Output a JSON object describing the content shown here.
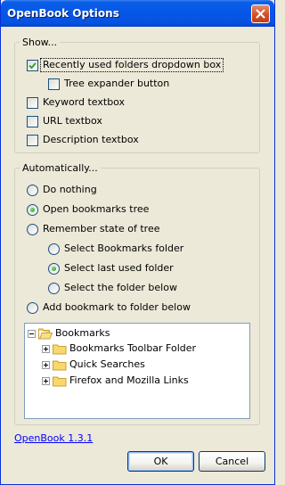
{
  "window": {
    "title": "OpenBook Options"
  },
  "show_group": {
    "title": "Show...",
    "items": [
      {
        "label": "Recently used folders dropdown box",
        "checked": true,
        "focused": true
      },
      {
        "label": "Tree expander button",
        "checked": false
      },
      {
        "label": "Keyword textbox",
        "checked": false
      },
      {
        "label": "URL textbox",
        "checked": false
      },
      {
        "label": "Description textbox",
        "checked": false
      }
    ]
  },
  "auto_group": {
    "title": "Automatically...",
    "options": [
      {
        "label": "Do nothing",
        "selected": false
      },
      {
        "label": "Open bookmarks tree",
        "selected": true
      },
      {
        "label": "Remember state of tree",
        "selected": false
      },
      {
        "label": "Select Bookmarks folder",
        "selected": false
      },
      {
        "label": "Select last used folder",
        "selected": true
      },
      {
        "label": "Select the folder below",
        "selected": false
      },
      {
        "label": "Add bookmark to folder below",
        "selected": false
      }
    ]
  },
  "tree": {
    "root": {
      "label": "Bookmarks",
      "expanded": true
    },
    "children": [
      {
        "label": "Bookmarks Toolbar Folder",
        "expanded": false
      },
      {
        "label": "Quick Searches",
        "expanded": false
      },
      {
        "label": "Firefox and Mozilla Links",
        "expanded": false
      }
    ]
  },
  "footer": {
    "version_link": "OpenBook 1.3.1"
  },
  "buttons": {
    "ok": "OK",
    "cancel": "Cancel"
  },
  "colors": {
    "titlebar": "#0758e8",
    "dialog_bg": "#ece9d8",
    "link": "#0000ff",
    "close_button": "#d3502a"
  },
  "icons": {
    "close": "close-icon",
    "checkmark": "checkmark-icon",
    "folder": "folder-icon",
    "expander": "tree-expander-icon"
  }
}
